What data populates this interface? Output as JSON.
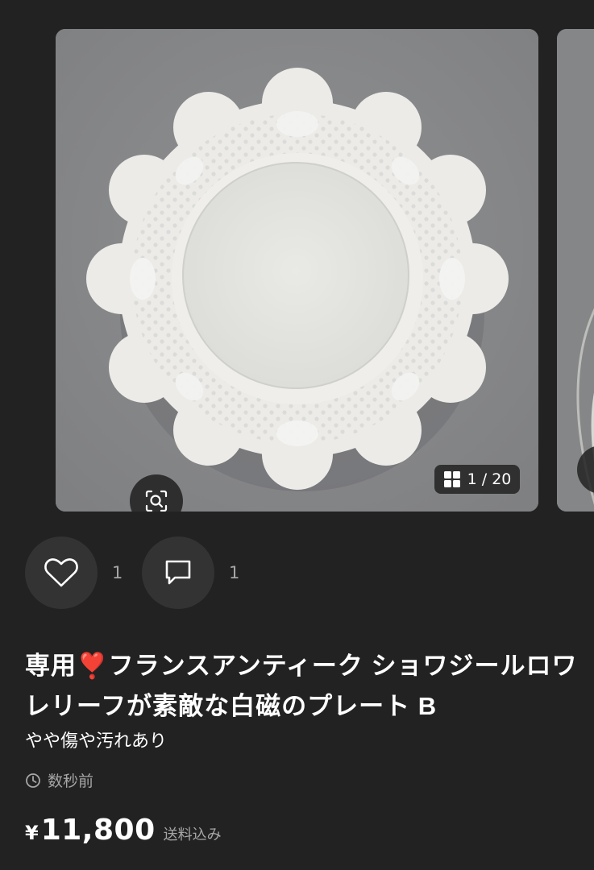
{
  "gallery": {
    "image_counter": "1 / 20",
    "zoom_icon": "image-search-icon",
    "grid_icon": "grid-icon"
  },
  "actions": {
    "like_icon": "heart-icon",
    "like_count": "1",
    "comment_icon": "comment-icon",
    "comment_count": "1"
  },
  "item": {
    "title": "専用❣️フランスアンティーク ショワジールロワ レリーフが素敵な白磁のプレート B",
    "condition": "やや傷や汚れあり",
    "posted_time": "数秒前",
    "currency_symbol": "¥",
    "price": "11,800",
    "shipping_note": "送料込み"
  },
  "colors": {
    "background": "#222222",
    "button_bg": "#333333",
    "muted_text": "#a6a6a6"
  }
}
